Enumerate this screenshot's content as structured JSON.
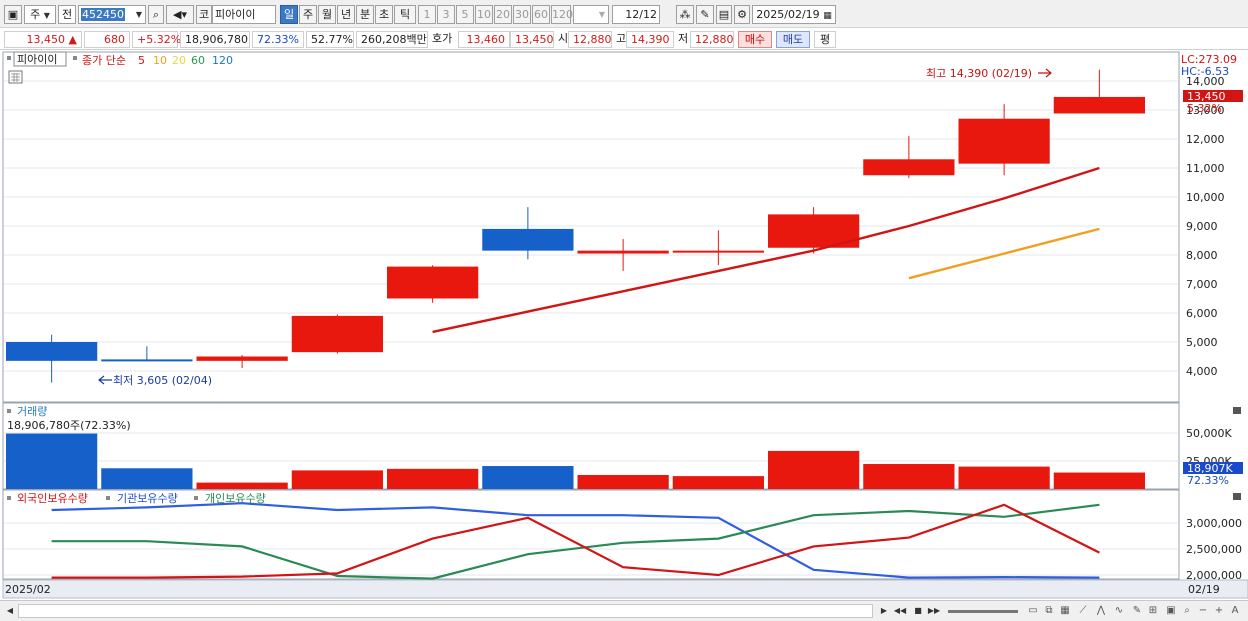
{
  "toolbar": {
    "market": "주",
    "type": "전",
    "code": "452450",
    "stock_name": "피아이이",
    "market_tag": "코",
    "periods": [
      "일",
      "주",
      "월",
      "년",
      "분",
      "초",
      "틱"
    ],
    "active_period": "일",
    "intervals": [
      "1",
      "3",
      "5",
      "10",
      "20",
      "30",
      "60",
      "120"
    ],
    "range": "12/12",
    "date": "2025/02/19"
  },
  "quote": {
    "price": "13,450",
    "change": "680",
    "change_pct": "+5.32%",
    "volume": "18,906,780",
    "volume_ratio": "72.33%",
    "turnover_pct": "52.77%",
    "amount": "260,208백만",
    "hoga_label": "호가",
    "hoga_ask": "13,460",
    "hoga_bid": "13,450",
    "open_label": "시",
    "open": "12,880",
    "high_label": "고",
    "high": "14,390",
    "low_label": "저",
    "low": "12,880",
    "buy_label": "매수",
    "sell_label": "매도",
    "avg_label": "평"
  },
  "chart": {
    "header_name": "피아이이",
    "ma_title": "종가 단순",
    "ma_periods": [
      {
        "label": "5",
        "color": "#d11414"
      },
      {
        "label": "10",
        "color": "#f0a020"
      },
      {
        "label": "20",
        "color": "#e8d83c"
      },
      {
        "label": "60",
        "color": "#2a9a4a"
      },
      {
        "label": "120",
        "color": "#1f75c9"
      }
    ],
    "lc": "LC:273.09",
    "hc": "HC:-6.53",
    "price_label": "13,450",
    "price_pct": "5.32%",
    "high_annot": "최고 14,390 (02/19)",
    "low_annot": "최저 3,605 (02/04)",
    "price_axis": [
      "14,000",
      "13,000",
      "12,000",
      "11,000",
      "10,000",
      "9,000",
      "8,000",
      "7,000",
      "6,000",
      "5,000",
      "4,000"
    ]
  },
  "volume_panel": {
    "title": "거래량",
    "current": "18,906,780주(72.33%)",
    "axis": [
      "50,000K",
      "25,000K"
    ],
    "value_label": "18,907K",
    "value_pct": "72.33%"
  },
  "holdings_panel": {
    "legend": [
      "외국인보유수량",
      "기관보유수량",
      "개인보유수량"
    ],
    "axis": [
      "3,000,000",
      "2,500,000",
      "2,000,000"
    ]
  },
  "date_axis": {
    "left": "2025/02",
    "right": "02/19"
  },
  "chart_data": {
    "type": "candlestick",
    "candles": [
      {
        "o": 5000,
        "h": 5250,
        "l": 3600,
        "c": 4350,
        "dir": "down"
      },
      {
        "o": 4400,
        "h": 4850,
        "l": 4350,
        "c": 4350,
        "dir": "down"
      },
      {
        "o": 4350,
        "h": 4550,
        "l": 4100,
        "c": 4500,
        "dir": "up"
      },
      {
        "o": 4650,
        "h": 5950,
        "l": 4600,
        "c": 5900,
        "dir": "up"
      },
      {
        "o": 6500,
        "h": 7650,
        "l": 6350,
        "c": 7600,
        "dir": "up"
      },
      {
        "o": 8900,
        "h": 9650,
        "l": 7850,
        "c": 8150,
        "dir": "down"
      },
      {
        "o": 8050,
        "h": 8550,
        "l": 7450,
        "c": 8150,
        "dir": "up"
      },
      {
        "o": 8100,
        "h": 8850,
        "l": 7650,
        "c": 8150,
        "dir": "up"
      },
      {
        "o": 8250,
        "h": 9650,
        "l": 8050,
        "c": 9400,
        "dir": "up"
      },
      {
        "o": 10750,
        "h": 12100,
        "l": 10650,
        "c": 11300,
        "dir": "up"
      },
      {
        "o": 11150,
        "h": 13200,
        "l": 10750,
        "c": 12700,
        "dir": "up"
      },
      {
        "o": 12880,
        "h": 14390,
        "l": 12880,
        "c": 13450,
        "dir": "up"
      }
    ],
    "ma5": [
      null,
      null,
      null,
      null,
      5350,
      6050,
      6750,
      7450,
      8150,
      9000,
      9950,
      11000
    ],
    "ma10": [
      null,
      null,
      null,
      null,
      null,
      null,
      null,
      null,
      null,
      7200,
      8050,
      8900
    ],
    "volume_k": [
      49500,
      18500,
      5700,
      16600,
      18000,
      20500,
      12500,
      11500,
      34000,
      22300,
      20000,
      14700
    ],
    "volume_dir": [
      "down",
      "down",
      "up",
      "up",
      "up",
      "down",
      "up",
      "up",
      "up",
      "up",
      "up",
      "up"
    ],
    "holdings": {
      "foreign": [
        1950000,
        1950000,
        1970000,
        2030000,
        2700000,
        3100000,
        2150000,
        2000000,
        2550000,
        2720000,
        3350000,
        2430000
      ],
      "institution": [
        3250000,
        3300000,
        3380000,
        3250000,
        3300000,
        3150000,
        3150000,
        3100000,
        2100000,
        1950000,
        1960000,
        1950000
      ],
      "individual": [
        2650000,
        2650000,
        2550000,
        1980000,
        1930000,
        2400000,
        2620000,
        2700000,
        3150000,
        3230000,
        3120000,
        3350000
      ]
    }
  }
}
